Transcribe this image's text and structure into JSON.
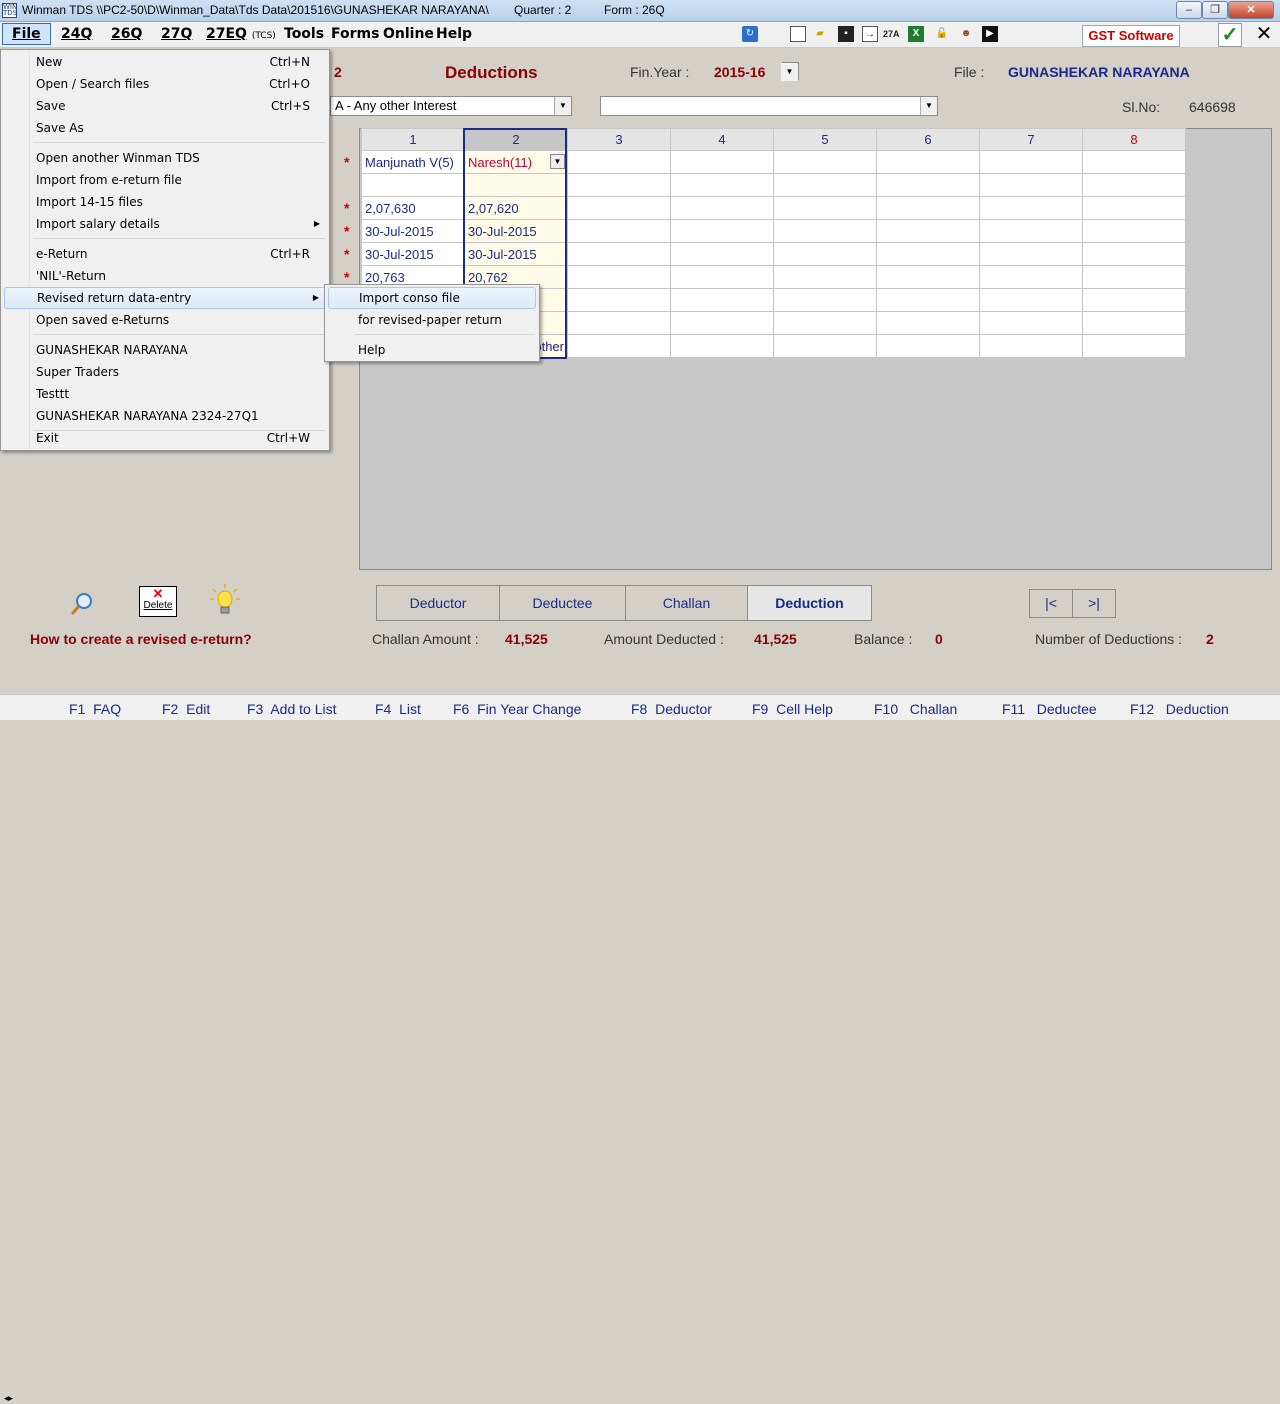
{
  "window": {
    "title": "Winman TDS \\\\PC2-50\\D\\Winman_Data\\Tds Data\\201516\\GUNASHEKAR NARAYANA\\",
    "quarter": "Quarter : 2",
    "form": "Form : 26Q",
    "icon_text": "WIN TDS"
  },
  "menu": {
    "file": "File",
    "q24": "24Q",
    "q26": "26Q",
    "q27": "27Q",
    "q27eq": "27EQ",
    "q27eq_small": "(TCS)",
    "tools": "Tools",
    "forms": "Forms",
    "online": "Online",
    "help": "Help"
  },
  "toolbar": {
    "gst_label": "GST Software",
    "check": "✓",
    "close": "✕",
    "icons": [
      "refresh-icon",
      "new-doc-icon",
      "open-folder-icon",
      "save-icon",
      "export-icon",
      "27a-icon",
      "excel-icon",
      "lock-icon",
      "user-icon",
      "film-icon"
    ],
    "label_27a": "27A"
  },
  "header": {
    "fragment_num": "2",
    "title": "Deductions",
    "fin_year_label": "Fin.Year :",
    "fin_year": "2015-16",
    "file_label": "File :",
    "file_name": "GUNASHEKAR NARAYANA",
    "section_combo": "A - Any other Interest",
    "second_combo": "",
    "slno_label": "Sl.No:",
    "slno": "646698"
  },
  "file_menu": {
    "items": [
      {
        "label": "New",
        "shortcut": "Ctrl+N"
      },
      {
        "label": "Open / Search files",
        "shortcut": "Ctrl+O"
      },
      {
        "label": "Save",
        "shortcut": "Ctrl+S"
      },
      {
        "label": "Save As",
        "shortcut": ""
      },
      {
        "label": "Open another Winman TDS",
        "shortcut": ""
      },
      {
        "label": "Import from e-return file",
        "shortcut": ""
      },
      {
        "label": "Import 14-15 files",
        "shortcut": ""
      },
      {
        "label": "Import salary details",
        "shortcut": "▶"
      },
      {
        "label": "e-Return",
        "shortcut": "Ctrl+R"
      },
      {
        "label": "'NIL'-Return",
        "shortcut": ""
      },
      {
        "label": "Revised return data-entry",
        "shortcut": "▶"
      },
      {
        "label": "Open saved e-Returns",
        "shortcut": ""
      },
      {
        "label": "GUNASHEKAR NARAYANA",
        "shortcut": ""
      },
      {
        "label": "Super Traders",
        "shortcut": ""
      },
      {
        "label": "Testtt",
        "shortcut": ""
      },
      {
        "label": "GUNASHEKAR NARAYANA 2324-27Q1",
        "shortcut": ""
      },
      {
        "label": "Exit",
        "shortcut": "Ctrl+W"
      }
    ]
  },
  "submenu": {
    "items": [
      "Import conso file",
      "for revised-paper return",
      "Help"
    ]
  },
  "grid": {
    "headers": [
      "1",
      "2",
      "3",
      "4",
      "5",
      "6",
      "7",
      "8"
    ],
    "rows": [
      [
        "Manjunath V(5)",
        "Naresh(11)",
        "",
        "",
        "",
        "",
        "",
        ""
      ],
      [
        "",
        "",
        "",
        "",
        "",
        "",
        "",
        ""
      ],
      [
        "2,07,630",
        "2,07,620",
        "",
        "",
        "",
        "",
        "",
        ""
      ],
      [
        "30-Jul-2015",
        "30-Jul-2015",
        "",
        "",
        "",
        "",
        "",
        ""
      ],
      [
        "30-Jul-2015",
        "30-Jul-2015",
        "",
        "",
        "",
        "",
        "",
        ""
      ],
      [
        "20,763",
        "20,762",
        "",
        "",
        "",
        "",
        "",
        ""
      ],
      [
        "",
        "",
        "",
        "",
        "",
        "",
        "",
        ""
      ],
      [
        "",
        "",
        "",
        "",
        "",
        "",
        "",
        ""
      ],
      [
        "",
        "other",
        "",
        "",
        "",
        "",
        "",
        ""
      ]
    ],
    "star": "*"
  },
  "tabs": [
    "Deductor",
    "Deductee",
    "Challan",
    "Deduction"
  ],
  "nav": {
    "first": "|<",
    "last": ">|"
  },
  "actions": {
    "delete_label": "Delete",
    "delete_x": "✕"
  },
  "footer": {
    "revised_link": "How to create a revised e-return?",
    "challan_amount_label": "Challan Amount :",
    "challan_amount": "41,525",
    "amount_deducted_label": "Amount Deducted :",
    "amount_deducted": "41,525",
    "balance_label": "Balance :",
    "balance": "0",
    "num_deductions_label": "Number of Deductions :",
    "num_deductions": "2"
  },
  "status": {
    "keys": [
      "F1  FAQ",
      "F2  Edit",
      "F3  Add to List",
      "F4  List",
      "F6  Fin Year Change",
      "F8  Deductor",
      "F9  Cell Help",
      "F10   Challan",
      "F11   Deductee",
      "F12   Deduction"
    ]
  }
}
